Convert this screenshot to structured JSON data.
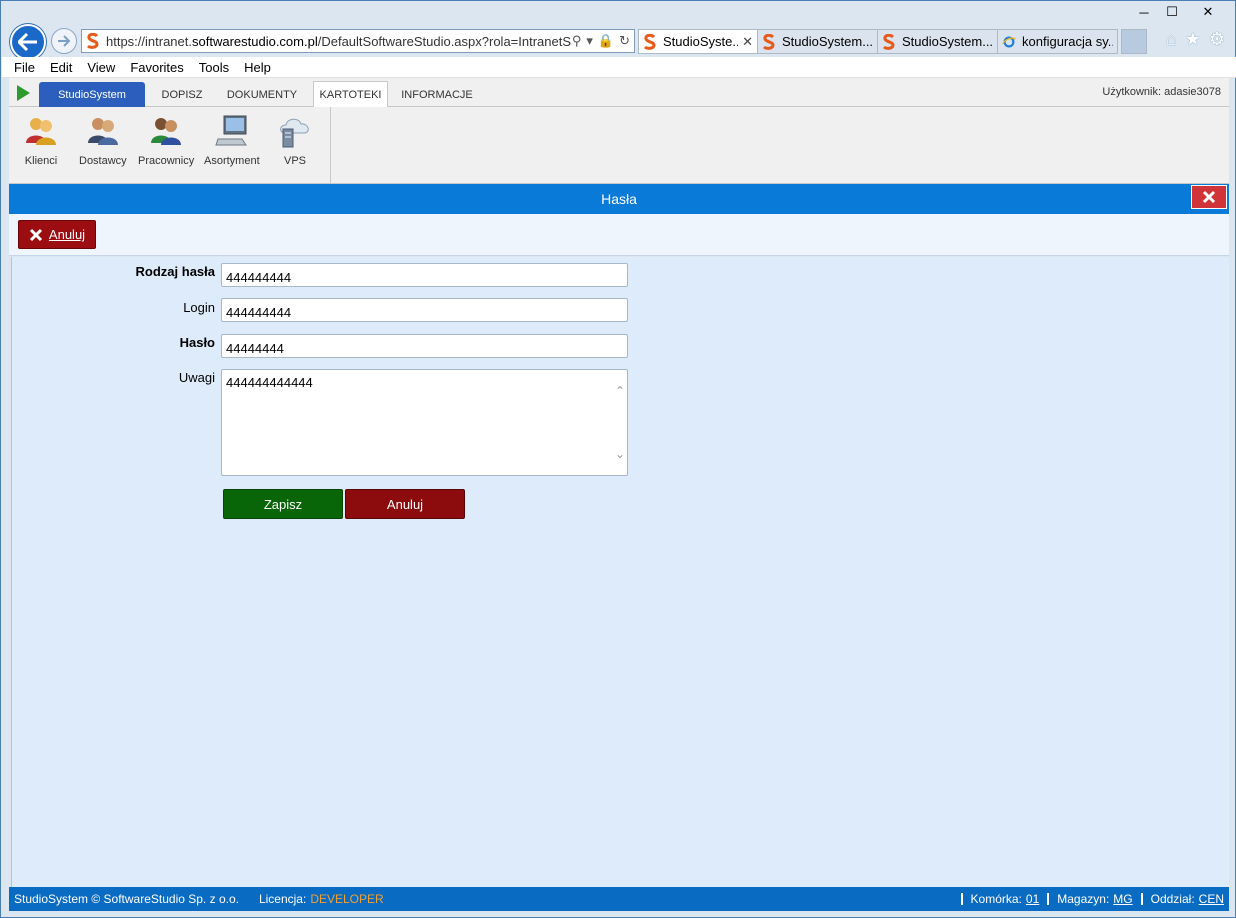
{
  "browser": {
    "url_prefix": "https://intranet.",
    "url_domain": "softwarestudio.com.pl",
    "url_path": "/DefaultSoftwareStudio.aspx?rola=IntranetSS&ro",
    "tabs": [
      {
        "label": "StudioSyste...",
        "icon": "studiosystem-s-icon"
      },
      {
        "label": "StudioSystem....",
        "icon": "studiosystem-s-icon"
      },
      {
        "label": "StudioSystem....",
        "icon": "studiosystem-s-icon"
      },
      {
        "label": "konfiguracja sy...",
        "icon": "ie-icon"
      }
    ]
  },
  "menu": {
    "file": "File",
    "edit": "Edit",
    "view": "View",
    "favorites": "Favorites",
    "tools": "Tools",
    "help": "Help"
  },
  "app": {
    "brand_tab": "StudioSystem",
    "tabs": [
      "DOPISZ",
      "DOKUMENTY",
      "KARTOTEKI",
      "INFORMACJE"
    ],
    "user_label": "Użytkownik: adasie3078",
    "ribbon": [
      {
        "label": "Klienci",
        "icon": "clients-icon"
      },
      {
        "label": "Dostawcy",
        "icon": "suppliers-icon"
      },
      {
        "label": "Pracownicy",
        "icon": "employees-icon"
      },
      {
        "label": "Asortyment",
        "icon": "computer-icon"
      },
      {
        "label": "VPS",
        "icon": "cloud-server-icon"
      }
    ]
  },
  "dialog": {
    "title": "Hasła",
    "toolbar_cancel": "Anuluj",
    "fields": {
      "type_label": "Rodzaj hasła",
      "type_value": "444444444",
      "login_label": "Login",
      "login_value": "444444444",
      "password_label": "Hasło",
      "password_value": "44444444",
      "notes_label": "Uwagi",
      "notes_value": "444444444444"
    },
    "save_label": "Zapisz",
    "cancel_label": "Anuluj"
  },
  "status": {
    "copyright": "StudioSystem © SoftwareStudio Sp. z o.o.",
    "license_label": "Licencja:",
    "license_value": "DEVELOPER",
    "cell_label": "Komórka:",
    "cell_value": "01",
    "warehouse_label": "Magazyn:",
    "warehouse_value": "MG",
    "branch_label": "Oddział:",
    "branch_value": "CEN"
  },
  "colors": {
    "accent": "#0a7ad8",
    "brand_tab": "#2c5fbd",
    "save": "#086508",
    "cancel": "#8c0c0e",
    "license": "#f0a030"
  }
}
